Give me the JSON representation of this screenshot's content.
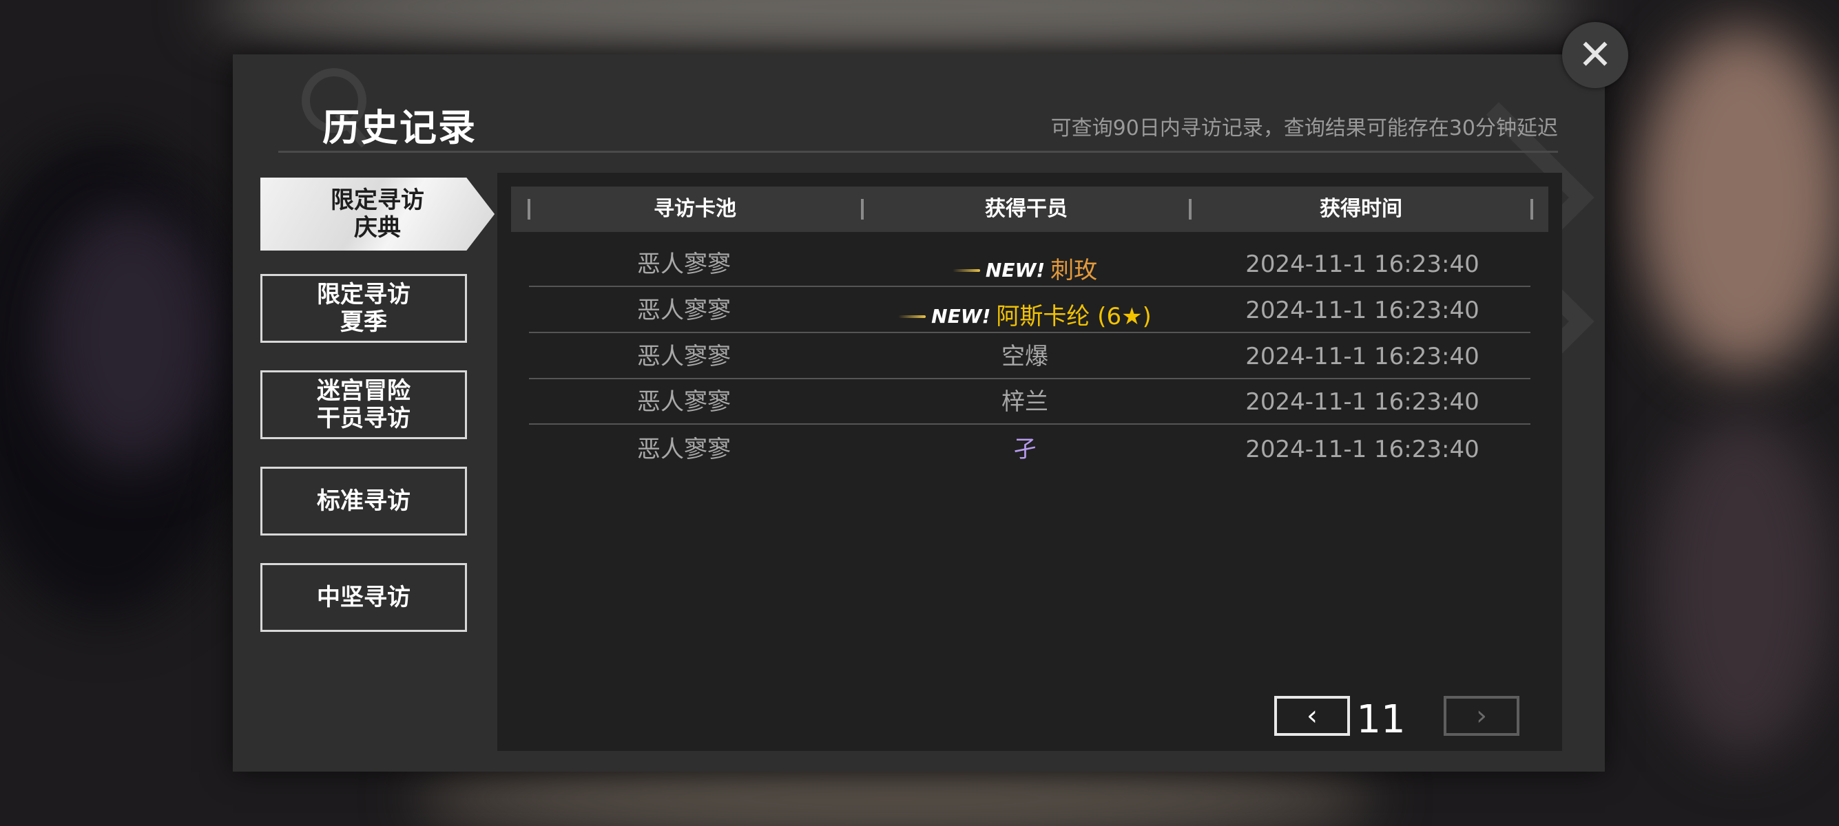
{
  "dialog": {
    "title": "历史记录",
    "subtitle": "可查询90日内寻访记录，查询结果可能存在30分钟延迟"
  },
  "tabs": [
    {
      "label": "限定寻访\n庆典",
      "active": true
    },
    {
      "label": "限定寻访\n夏季",
      "active": false
    },
    {
      "label": "迷宫冒险\n干员寻访",
      "active": false
    },
    {
      "label": "标准寻访",
      "active": false
    },
    {
      "label": "中坚寻访",
      "active": false
    }
  ],
  "table": {
    "headers": [
      "寻访卡池",
      "获得干员",
      "获得时间"
    ],
    "rows": [
      {
        "pool": "恶人寥寥",
        "new_badge": "NEW!",
        "operator": "刺玫",
        "time": "2024-11-1 16:23:40",
        "color": "#e39a3c"
      },
      {
        "pool": "恶人寥寥",
        "new_badge": "NEW!",
        "operator": "阿斯卡纶 (6★)",
        "time": "2024-11-1 16:23:40",
        "color": "#f3c300"
      },
      {
        "pool": "恶人寥寥",
        "new_badge": "",
        "operator": "空爆",
        "time": "2024-11-1 16:23:40",
        "color": "#a8a8a8"
      },
      {
        "pool": "恶人寥寥",
        "new_badge": "",
        "operator": "梓兰",
        "time": "2024-11-1 16:23:40",
        "color": "#a8a8a8"
      },
      {
        "pool": "恶人寥寥",
        "new_badge": "",
        "operator": "孑",
        "time": "2024-11-1 16:23:40",
        "color": "#b79bf0"
      }
    ]
  },
  "pager": {
    "current_page": "11",
    "prev_icon": "chevron-left-icon",
    "next_icon": "chevron-right-icon",
    "prev_glyph": "‹",
    "next_glyph": "›"
  },
  "close_icon": "close-icon",
  "close_glyph": "✕",
  "colors": {
    "panel_bg": "#202020",
    "dialog_bg": "#2f2f2f",
    "six_star": "#f3c300",
    "five_star": "#e39a3c",
    "four_star": "#b79bf0",
    "three_star": "#a8a8a8"
  }
}
